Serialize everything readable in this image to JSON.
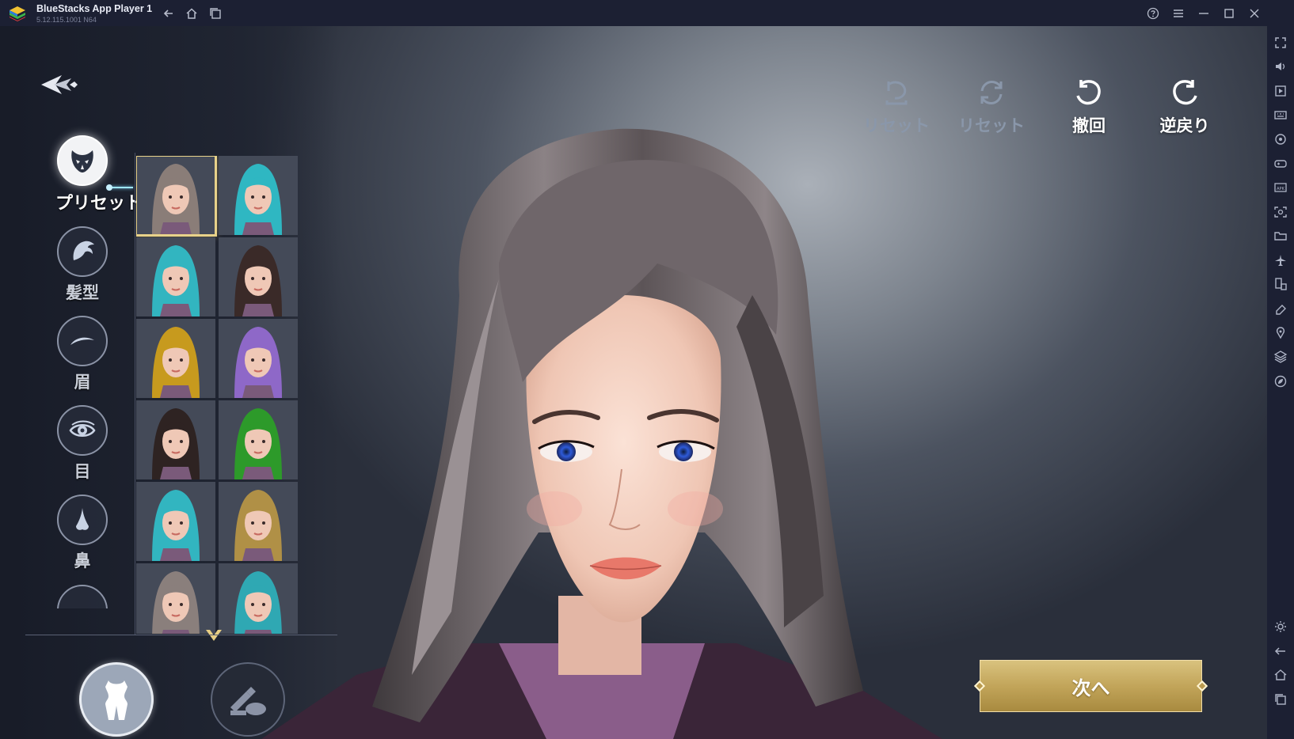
{
  "window": {
    "title": "BlueStacks App Player 1",
    "version": "5.12.115.1001  N64"
  },
  "titlebar_icons": [
    "back-icon",
    "home-icon",
    "multi-instance-icon",
    "help-icon",
    "menu-icon",
    "minimize-icon",
    "maximize-icon",
    "close-icon"
  ],
  "sidebar_icons": [
    "fullscreen-icon",
    "volume-icon",
    "media-icon",
    "keyboard-icon",
    "rotate-icon",
    "gamepad-icon",
    "apk-icon",
    "screenshot-icon",
    "folder-icon",
    "airplane-icon",
    "device-icon",
    "erase-icon",
    "location-icon",
    "layers-icon",
    "eco-icon",
    "settings-icon",
    "back-arrow-icon",
    "home-icon",
    "recent-apps-icon"
  ],
  "sidebar_apk_text": "APK",
  "categories": [
    {
      "label": "プリセット",
      "icon": "preset-mask-icon",
      "active": true
    },
    {
      "label": "髪型",
      "icon": "hair-icon",
      "active": false
    },
    {
      "label": "眉",
      "icon": "eyebrow-icon",
      "active": false
    },
    {
      "label": "目",
      "icon": "eye-icon",
      "active": false
    },
    {
      "label": "鼻",
      "icon": "nose-icon",
      "active": false
    }
  ],
  "presets": [
    {
      "hair_color": "#8a7d78",
      "selected": true
    },
    {
      "hair_color": "#2fb7c2",
      "selected": false
    },
    {
      "hair_color": "#32b5c0",
      "selected": false
    },
    {
      "hair_color": "#3a2a28",
      "selected": false
    },
    {
      "hair_color": "#c79a1e",
      "selected": false
    },
    {
      "hair_color": "#8e68c8",
      "selected": false
    },
    {
      "hair_color": "#2e2322",
      "selected": false
    },
    {
      "hair_color": "#2d9a2a",
      "selected": false
    },
    {
      "hair_color": "#32b5c0",
      "selected": false
    },
    {
      "hair_color": "#b09046",
      "selected": false
    },
    {
      "hair_color": "#8a7f7c",
      "selected": false
    },
    {
      "hair_color": "#2fa8b3",
      "selected": false
    }
  ],
  "actions": [
    {
      "label": "リセット",
      "icon": "reset-icon",
      "enabled": false
    },
    {
      "label": "リセット",
      "icon": "reset-all-icon",
      "enabled": false
    },
    {
      "label": "撤回",
      "icon": "undo-icon",
      "enabled": true
    },
    {
      "label": "逆戻り",
      "icon": "redo-icon",
      "enabled": true
    }
  ],
  "modes": [
    {
      "name": "body-mode",
      "icon": "body-icon",
      "active": true
    },
    {
      "name": "makeup-mode",
      "icon": "makeup-icon",
      "active": false
    }
  ],
  "next_button": {
    "label": "次へ"
  },
  "colors": {
    "accent_gold": "#c8ab62",
    "selection_outline": "#e8d28a",
    "connector": "#9fe7ff",
    "character_hair": "#5e5658"
  }
}
